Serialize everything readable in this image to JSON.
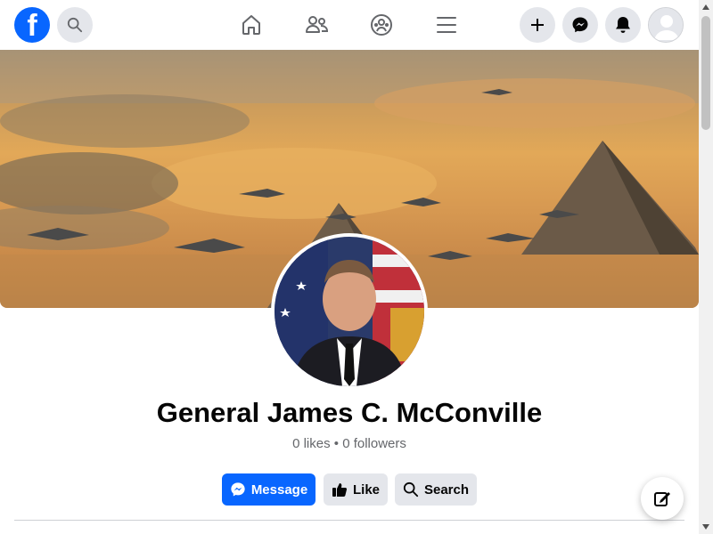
{
  "topbar": {
    "logo_letter": "f",
    "icons": [
      "facebook-logo",
      "search-icon",
      "home-icon",
      "friends-icon",
      "groups-icon",
      "menu-icon",
      "plus-icon",
      "messenger-icon",
      "bell-icon",
      "avatar"
    ]
  },
  "profile": {
    "name": "General James C. McConville",
    "stats": "0 likes • 0 followers"
  },
  "actions": {
    "message_label": "Message",
    "like_label": "Like",
    "search_label": "Search"
  },
  "colors": {
    "brand": "#0866ff",
    "secondary_bg": "#e4e6eb",
    "text_primary": "#050505",
    "text_secondary": "#65676b"
  }
}
